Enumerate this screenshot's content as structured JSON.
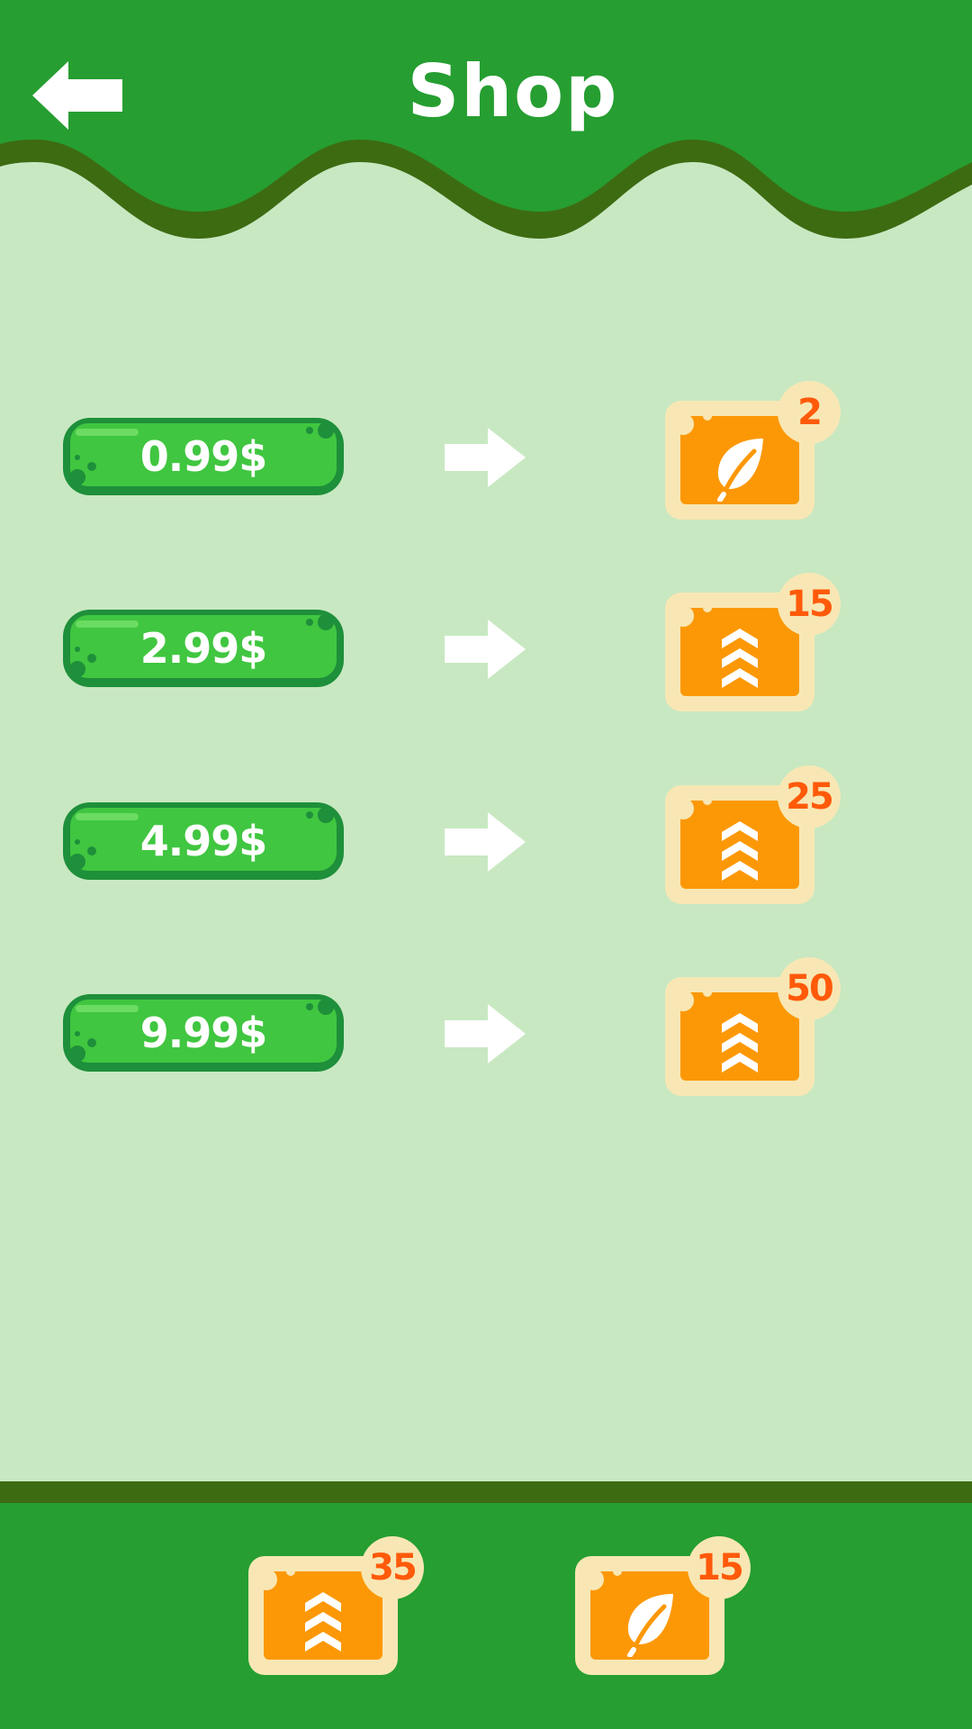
{
  "header": {
    "title": "Shop",
    "back_icon": "back-arrow-icon"
  },
  "colors": {
    "header_green": "#269e31",
    "header_wave_dark": "#3d6b12",
    "background": "#c8e8c2",
    "price_button": "#40c640",
    "price_button_border": "#1e8f3a",
    "tile_orange": "#fc9806",
    "tile_cream": "#f8e7b4",
    "badge_text": "#ff5a0a"
  },
  "offers": [
    {
      "price": "0.99$",
      "reward_icon": "leaf-icon",
      "amount": "2"
    },
    {
      "price": "2.99$",
      "reward_icon": "rank-chevrons-icon",
      "amount": "15"
    },
    {
      "price": "4.99$",
      "reward_icon": "rank-chevrons-icon",
      "amount": "25"
    },
    {
      "price": "9.99$",
      "reward_icon": "rank-chevrons-icon",
      "amount": "50"
    }
  ],
  "inventory": [
    {
      "icon": "rank-chevrons-icon",
      "amount": "35"
    },
    {
      "icon": "leaf-icon",
      "amount": "15"
    }
  ]
}
